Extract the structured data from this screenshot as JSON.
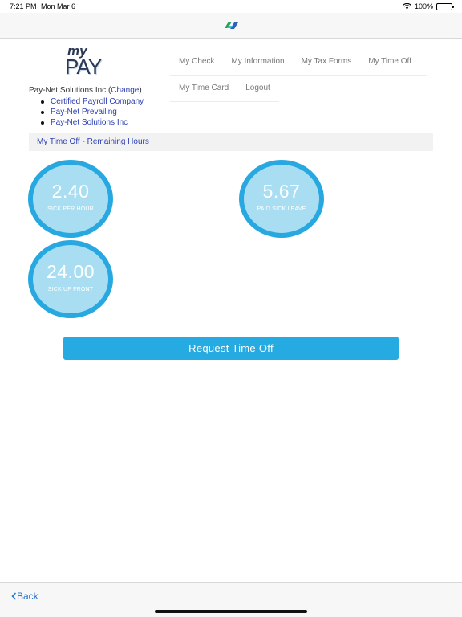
{
  "status_bar": {
    "time": "7:21 PM",
    "date": "Mon Mar 6",
    "battery": "100%",
    "battery_level": 1.0
  },
  "brand": {
    "logo_top": "my",
    "logo_bottom": "PAY"
  },
  "company": {
    "name": "Pay-Net Solutions Inc",
    "open_paren": "(",
    "change_label": "Change",
    "close_paren": ")",
    "list": [
      "Certified Payroll Company",
      "Pay-Net Prevailing",
      "Pay-Net Solutions Inc"
    ]
  },
  "nav": {
    "row1": [
      "My Check",
      "My Information",
      "My Tax Forms",
      "My Time Off"
    ],
    "row2": [
      "My Time Card",
      "Logout"
    ]
  },
  "section": {
    "title": "My Time Off - Remaining Hours"
  },
  "balances": [
    {
      "value": "2.40",
      "label": "SICK PER HOUR"
    },
    {
      "value": "5.67",
      "label": "PAID SICK LEAVE"
    },
    {
      "value": "24.00",
      "label": "SICK UP FRONT"
    }
  ],
  "actions": {
    "request_label": "Request Time Off"
  },
  "footer": {
    "back_label": "Back"
  },
  "colors": {
    "accent": "#27a8e0",
    "circle_fill": "#a9def2",
    "link": "#2b3eb0"
  }
}
